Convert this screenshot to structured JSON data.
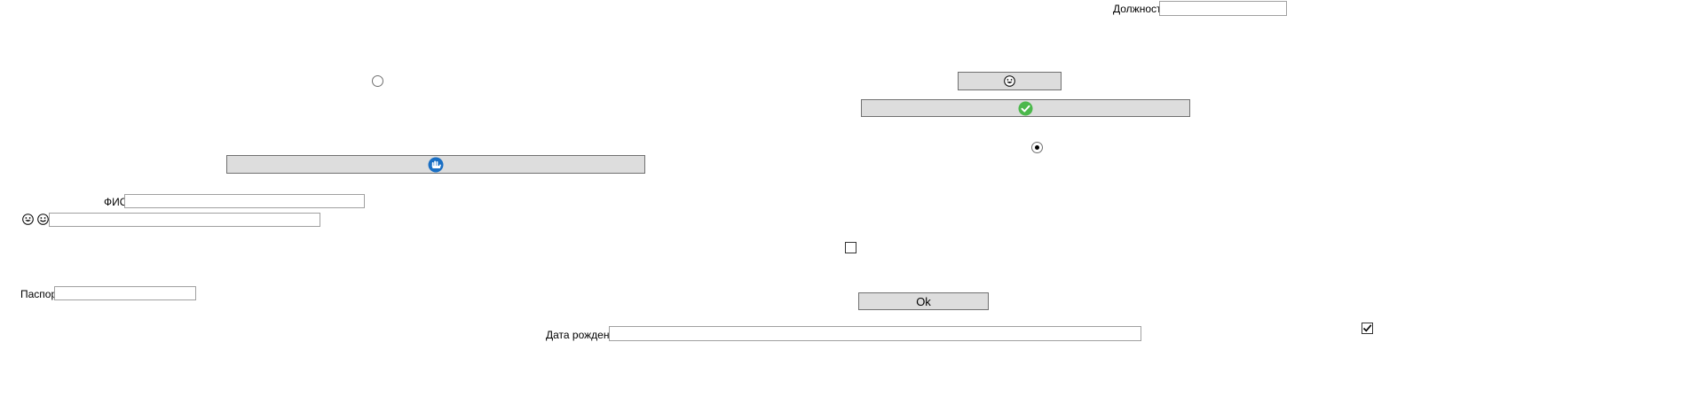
{
  "fields": {
    "position_label": "Должность",
    "position_value": "",
    "fio_label": "ФИО",
    "fio_value": "",
    "emoji_field_value": "",
    "passport_label": "Паспорт",
    "passport_value": "",
    "birthdate_label": "Дата рождения",
    "birthdate_value": ""
  },
  "buttons": {
    "ok_label": "Ok",
    "smiley_button_icon": "grinning-face-icon",
    "confirm_button_icon": "green-check-icon",
    "blue_button_icon": "blue-hand-icon"
  },
  "radios": {
    "left_radio_checked": false,
    "right_radio_checked": true
  },
  "checkboxes": {
    "middle_checkbox_checked": false,
    "corner_checkbox_checked": true
  },
  "labels": {
    "emoji_label_icons": [
      "grinning-face-icon",
      "smiling-face-icon"
    ]
  },
  "colors": {
    "button_bg": "#dddddd",
    "check_green": "#4cb84c",
    "blue_icon": "#1a6fc4"
  }
}
